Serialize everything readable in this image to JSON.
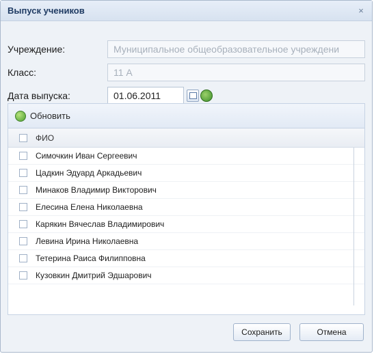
{
  "window": {
    "title": "Выпуск учеников",
    "close": "×"
  },
  "form": {
    "institution_label": "Учреждение:",
    "institution_value": "Муниципальное общеобразовательное учреждени",
    "class_label": "Класс:",
    "class_value": "11 А",
    "date_label": "Дата выпуска:",
    "date_value": "01.06.2011"
  },
  "toolbar": {
    "refresh_label": "Обновить"
  },
  "grid": {
    "header": "ФИО",
    "rows": [
      "Симочкин Иван Сергеевич",
      "Цадкин Эдуард Аркадьевич",
      "Минаков Владимир Викторович",
      "Елесина Елена Николаевна",
      "Карякин Вячеслав Владимирович",
      "Левина Ирина Николаевна",
      "Тетерина Раиса Филипповна",
      "Кузовкин Дмитрий Эдшарович"
    ]
  },
  "footer": {
    "save_label": "Сохранить",
    "cancel_label": "Отмена"
  }
}
